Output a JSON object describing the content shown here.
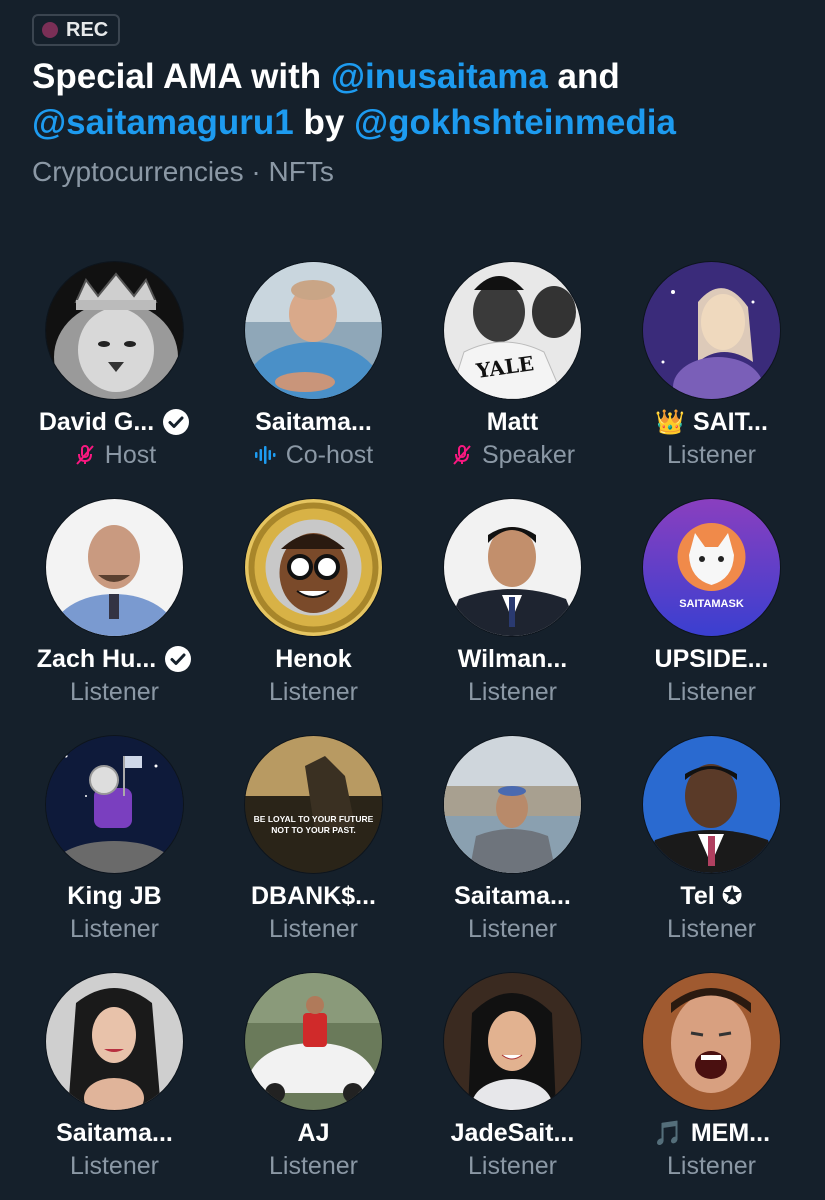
{
  "rec_badge": {
    "label": "REC"
  },
  "title": {
    "part1": "Special AMA with ",
    "mention1": "@inusaitama",
    "part2": " and ",
    "mention2": "@saitamaguru1",
    "part3": " by ",
    "mention3": "@gokhshteinmedia"
  },
  "topics": "Cryptocurrencies · NFTs",
  "colors": {
    "background": "#15202b",
    "mention": "#1d9bf0",
    "muted": "#8b98a5",
    "muted_mic": "#f91880",
    "speaking_wave": "#1d9bf0",
    "rec_dot": "#7a2f56"
  },
  "participants": [
    {
      "name": "David G...",
      "role": "Host",
      "verified": true,
      "role_icon": "muted-mic-icon",
      "prefix": ""
    },
    {
      "name": "Saitama...",
      "role": "Co-host",
      "verified": false,
      "role_icon": "speaking-wave-icon",
      "prefix": ""
    },
    {
      "name": "Matt",
      "role": "Speaker",
      "verified": false,
      "role_icon": "muted-mic-icon",
      "prefix": ""
    },
    {
      "name": "SAIT...",
      "role": "Listener",
      "verified": false,
      "role_icon": "",
      "prefix": "👑"
    },
    {
      "name": "Zach Hu...",
      "role": "Listener",
      "verified": true,
      "role_icon": "",
      "prefix": ""
    },
    {
      "name": "Henok",
      "role": "Listener",
      "verified": false,
      "role_icon": "",
      "prefix": ""
    },
    {
      "name": "Wilman...",
      "role": "Listener",
      "verified": false,
      "role_icon": "",
      "prefix": ""
    },
    {
      "name": "UPSIDE...",
      "role": "Listener",
      "verified": false,
      "role_icon": "",
      "prefix": ""
    },
    {
      "name": "King JB",
      "role": "Listener",
      "verified": false,
      "role_icon": "",
      "prefix": ""
    },
    {
      "name": "DBANK$...",
      "role": "Listener",
      "verified": false,
      "role_icon": "",
      "prefix": ""
    },
    {
      "name": "Saitama...",
      "role": "Listener",
      "verified": false,
      "role_icon": "",
      "prefix": ""
    },
    {
      "name": "Tel ✪",
      "role": "Listener",
      "verified": false,
      "role_icon": "",
      "prefix": ""
    },
    {
      "name": "Saitama...",
      "role": "Listener",
      "verified": false,
      "role_icon": "",
      "prefix": ""
    },
    {
      "name": "AJ",
      "role": "Listener",
      "verified": false,
      "role_icon": "",
      "prefix": ""
    },
    {
      "name": "JadeSait...",
      "role": "Listener",
      "verified": false,
      "role_icon": "",
      "prefix": ""
    },
    {
      "name": "MEM...",
      "role": "Listener",
      "verified": false,
      "role_icon": "",
      "prefix": "🎵"
    }
  ],
  "avatar_texts": {
    "matt_shirt": "YALE",
    "upside_logo": "SAITAMASK",
    "dbank_quote_1": "BE LOYAL TO YOUR FUTURE",
    "dbank_quote_2": "NOT TO YOUR PAST."
  }
}
